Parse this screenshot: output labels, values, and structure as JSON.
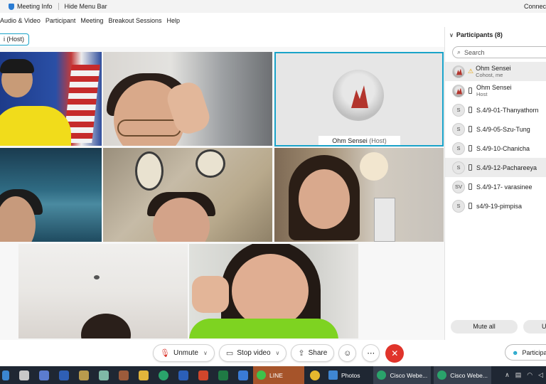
{
  "topbar": {
    "meeting_info": "Meeting Info",
    "hide_menu_bar": "Hide Menu Bar",
    "status": "Connec"
  },
  "menu": {
    "items": [
      "Audio & Video",
      "Participant",
      "Meeting",
      "Breakout Sessions",
      "Help"
    ]
  },
  "host_tag": "i (Host)",
  "active_tile": {
    "name": "Ohm Sensei",
    "role": "(Host)"
  },
  "controls": {
    "unmute": "Unmute",
    "stop_video": "Stop video",
    "share": "Share",
    "participants": "Participan"
  },
  "panel": {
    "title": "Participants (8)",
    "search_placeholder": "Search",
    "participants": [
      {
        "initials": "",
        "name": "Ohm Sensei",
        "sub": "Cohost, me"
      },
      {
        "initials": "",
        "name": "Ohm Sensei",
        "sub": "Host"
      },
      {
        "initials": "S",
        "name": "S.4/9-01-Thanyathorn",
        "sub": ""
      },
      {
        "initials": "S",
        "name": "S.4/9-05-Szu-Tung",
        "sub": ""
      },
      {
        "initials": "S",
        "name": "S.4/9-10-Chanicha",
        "sub": ""
      },
      {
        "initials": "S",
        "name": "S.4/9-12-Pachareeya",
        "sub": ""
      },
      {
        "initials": "SV",
        "name": "S.4/9-17- varasinee",
        "sub": ""
      },
      {
        "initials": "S",
        "name": "s4/9-19-pimpisa",
        "sub": ""
      }
    ],
    "mute_all": "Mute all",
    "unmute_all": "Un"
  },
  "taskbar": {
    "apps": [
      "LINE",
      "Photos",
      "Cisco Webe...",
      "Cisco Webe..."
    ]
  },
  "colors": {
    "accent": "#1aa3c9",
    "leave": "#e0342b",
    "taskbar": "#1f2733"
  }
}
